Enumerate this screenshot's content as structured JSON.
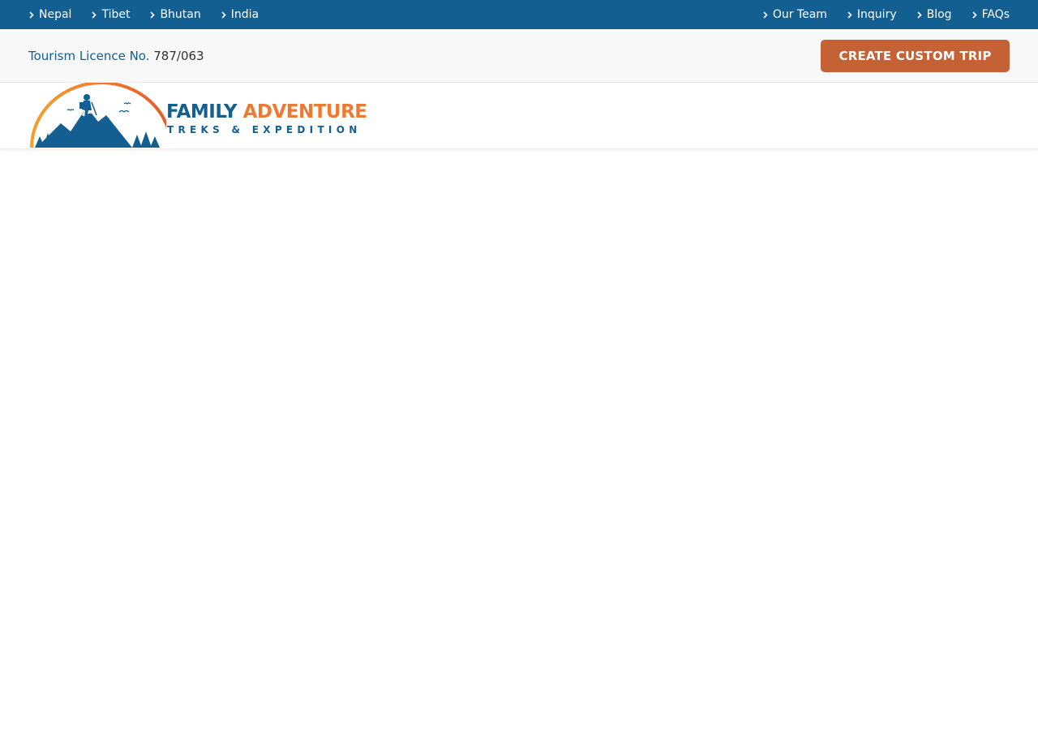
{
  "topbar": {
    "left_links": [
      {
        "label": "Nepal"
      },
      {
        "label": "Tibet"
      },
      {
        "label": "Bhutan"
      },
      {
        "label": "India"
      }
    ],
    "right_links": [
      {
        "label": "Our Team"
      },
      {
        "label": "Inquiry"
      },
      {
        "label": "Blog"
      },
      {
        "label": "FAQs"
      }
    ],
    "icon": "chevron-right-icon"
  },
  "infobar": {
    "licence_label": "Tourism Licence No.",
    "licence_number": "787/063",
    "cta_label": "CREATE CUSTOM TRIP"
  },
  "logo": {
    "word1": "FAMILY",
    "word2": "ADVENTURE",
    "tagline": "TREKS & EXPEDITION"
  },
  "colors": {
    "primary_blue": "#135f91",
    "accent_orange": "#ee7a2f",
    "cta_brown_orange": "#c46235",
    "infobar_bg": "#f8f8f8"
  }
}
